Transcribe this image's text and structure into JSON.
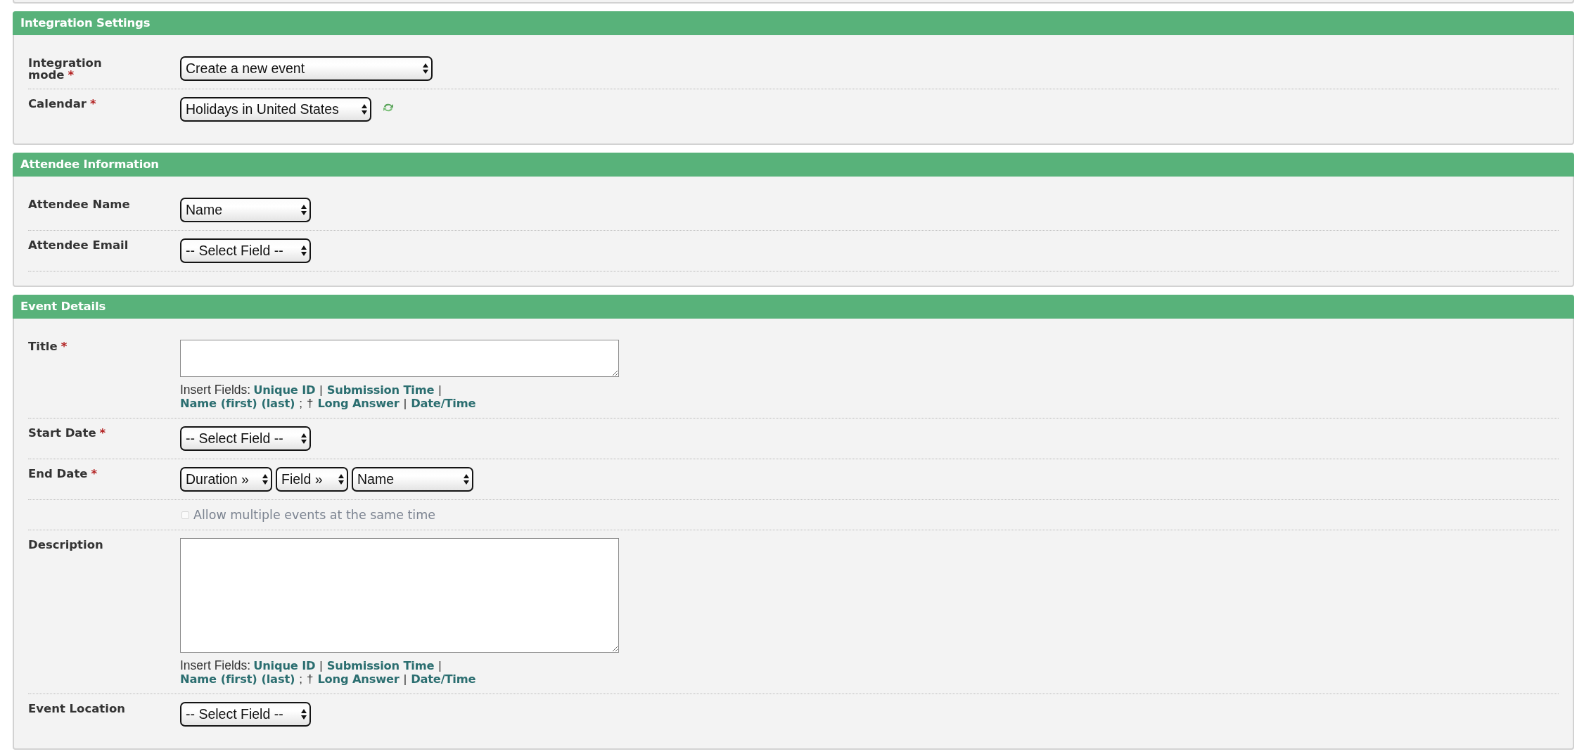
{
  "sections": [
    {
      "title": "Integration Settings",
      "trailing_divider": false,
      "rows": [
        {
          "label": "Integration mode",
          "required_mark": "*",
          "controls": [
            {
              "kind": "select",
              "value": "Create a new event"
            }
          ]
        },
        {
          "label": "Calendar",
          "required_mark": "*",
          "controls": [
            {
              "kind": "select",
              "value": "Holidays in United States"
            },
            {
              "kind": "refresh"
            }
          ]
        }
      ]
    },
    {
      "title": "Attendee Information",
      "trailing_divider": true,
      "rows": [
        {
          "label": "Attendee Name",
          "controls": [
            {
              "kind": "select",
              "value": "Name"
            }
          ]
        },
        {
          "label": "Attendee Email",
          "controls": [
            {
              "kind": "select",
              "value": "-- Select Field --"
            }
          ]
        }
      ]
    },
    {
      "title": "Event Details",
      "trailing_divider": false,
      "rows": [
        {
          "label": "Title",
          "required_mark": "*",
          "controls": [
            {
              "kind": "textarea"
            }
          ],
          "insert_fields": {
            "label": "Insert Fields:",
            "lines": [
              [
                {
                  "kind": "link",
                  "text": "Unique ID"
                },
                {
                  "kind": "separator",
                  "text": "|"
                },
                {
                  "kind": "link",
                  "text": "Submission Time"
                },
                {
                  "kind": "separator",
                  "text": "|"
                }
              ],
              [
                {
                  "kind": "link",
                  "text": "Name"
                },
                {
                  "kind": "link",
                  "text": "(first)"
                },
                {
                  "kind": "link",
                  "text": "(last)"
                },
                {
                  "kind": "separator",
                  "text": ";"
                },
                {
                  "kind": "separator",
                  "text": "†"
                },
                {
                  "kind": "link",
                  "text": "Long Answer"
                },
                {
                  "kind": "separator",
                  "text": "|"
                },
                {
                  "kind": "link",
                  "text": "Date/Time"
                }
              ]
            ]
          }
        },
        {
          "label": "Start Date",
          "required_mark": "*",
          "controls": [
            {
              "kind": "select",
              "value": "-- Select Field --"
            }
          ]
        },
        {
          "label": "End Date",
          "required_mark": "*",
          "controls": [
            {
              "kind": "select",
              "value": "Duration »"
            },
            {
              "kind": "select",
              "value": "Field »"
            },
            {
              "kind": "select",
              "value": "Name"
            }
          ]
        },
        {
          "controls": [
            {
              "kind": "checkbox",
              "text": "Allow multiple events at the same time",
              "checked": false,
              "disabled": true
            }
          ]
        },
        {
          "label": "Description",
          "controls": [
            {
              "kind": "textarea"
            }
          ],
          "insert_fields": {
            "label": "Insert Fields:",
            "lines": [
              [
                {
                  "kind": "link",
                  "text": "Unique ID"
                },
                {
                  "kind": "separator",
                  "text": "|"
                },
                {
                  "kind": "link",
                  "text": "Submission Time"
                },
                {
                  "kind": "separator",
                  "text": "|"
                }
              ],
              [
                {
                  "kind": "link",
                  "text": "Name"
                },
                {
                  "kind": "link",
                  "text": "(first)"
                },
                {
                  "kind": "link",
                  "text": "(last)"
                },
                {
                  "kind": "separator",
                  "text": ";"
                },
                {
                  "kind": "separator",
                  "text": "†"
                },
                {
                  "kind": "link",
                  "text": "Long Answer"
                },
                {
                  "kind": "separator",
                  "text": "|"
                },
                {
                  "kind": "link",
                  "text": "Date/Time"
                }
              ]
            ]
          }
        },
        {
          "label": "Event Location",
          "controls": [
            {
              "kind": "select",
              "value": "-- Select Field --"
            }
          ]
        }
      ]
    }
  ]
}
